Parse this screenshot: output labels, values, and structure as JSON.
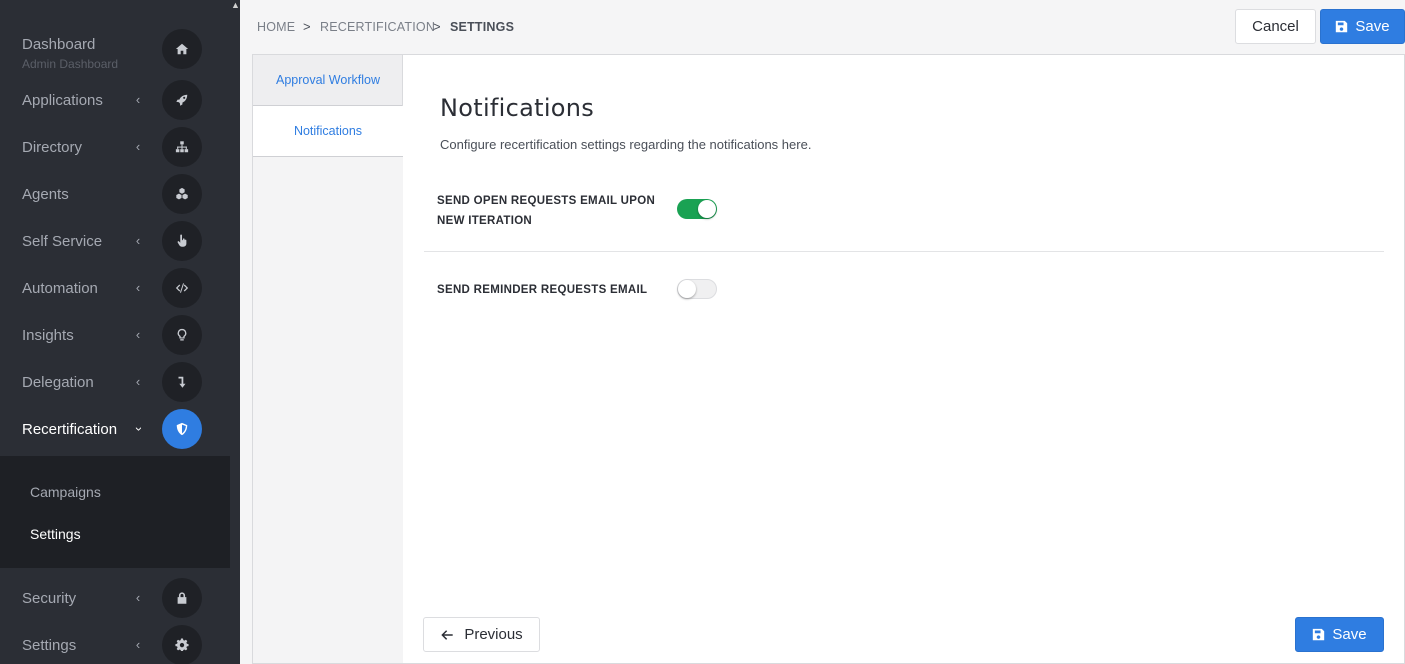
{
  "sidebar": {
    "items": [
      {
        "label": "Dashboard",
        "sublabel": "Admin Dashboard",
        "icon": "home-icon",
        "has_chevron": false
      },
      {
        "label": "Applications",
        "icon": "rocket-icon",
        "has_chevron": true
      },
      {
        "label": "Directory",
        "icon": "sitemap-icon",
        "has_chevron": true
      },
      {
        "label": "Agents",
        "icon": "cubes-icon",
        "has_chevron": false
      },
      {
        "label": "Self Service",
        "icon": "hand-pointer-icon",
        "has_chevron": true
      },
      {
        "label": "Automation",
        "icon": "code-icon",
        "has_chevron": true
      },
      {
        "label": "Insights",
        "icon": "lightbulb-icon",
        "has_chevron": true
      },
      {
        "label": "Delegation",
        "icon": "level-down-icon",
        "has_chevron": true
      },
      {
        "label": "Recertification",
        "icon": "shield-icon",
        "has_chevron": true,
        "expanded": true,
        "active": true
      },
      {
        "label": "Security",
        "icon": "lock-icon",
        "has_chevron": true
      },
      {
        "label": "Settings",
        "icon": "gear-icon",
        "has_chevron": true
      }
    ],
    "subitems": [
      {
        "label": "Campaigns",
        "active": false
      },
      {
        "label": "Settings",
        "active": true
      }
    ]
  },
  "breadcrumb": {
    "items": [
      "HOME",
      "RECERTIFICATION",
      "SETTINGS"
    ],
    "separator": ">"
  },
  "toolbar": {
    "cancel_label": "Cancel",
    "save_label": "Save"
  },
  "tabs": [
    {
      "label": "Approval Workflow",
      "active": false
    },
    {
      "label": "Notifications",
      "active": true
    }
  ],
  "content": {
    "title": "Notifications",
    "description": "Configure recertification settings regarding the notifications here.",
    "settings": [
      {
        "label": "SEND OPEN REQUESTS EMAIL UPON NEW ITERATION",
        "enabled": true
      },
      {
        "label": "SEND REMINDER REQUESTS EMAIL",
        "enabled": false
      }
    ]
  },
  "footer": {
    "previous_label": "Previous",
    "save_label": "Save"
  },
  "colors": {
    "sidebar_bg": "#2b2e35",
    "submenu_bg": "#1e2025",
    "accent": "#2f7de1",
    "toggle_on": "#1aa253"
  }
}
